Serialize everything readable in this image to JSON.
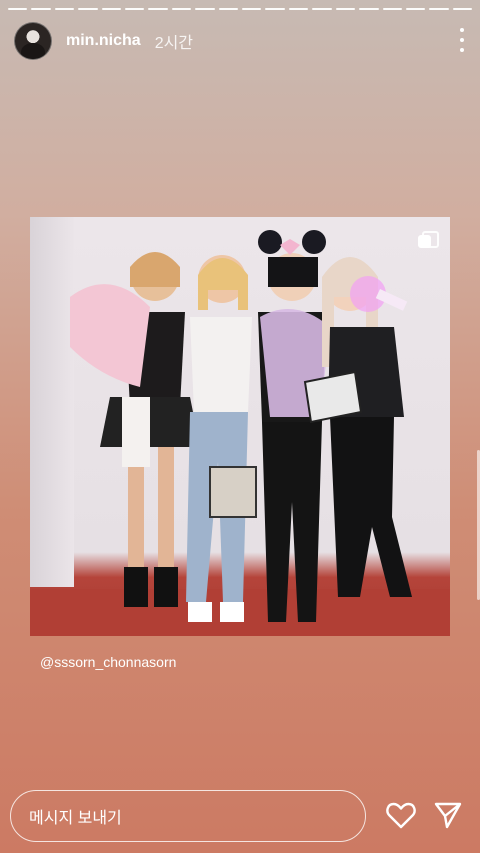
{
  "story": {
    "segment_count": 20,
    "current_segment": 20
  },
  "header": {
    "username": "min.nicha",
    "time": "2시간"
  },
  "post": {
    "mention": "@sssorn_chonnasorn"
  },
  "footer": {
    "message_placeholder": "메시지 보내기"
  },
  "icons": {
    "more": "more-vertical-icon",
    "multi": "multiple-photos-icon",
    "like": "heart-icon",
    "send": "send-icon"
  }
}
